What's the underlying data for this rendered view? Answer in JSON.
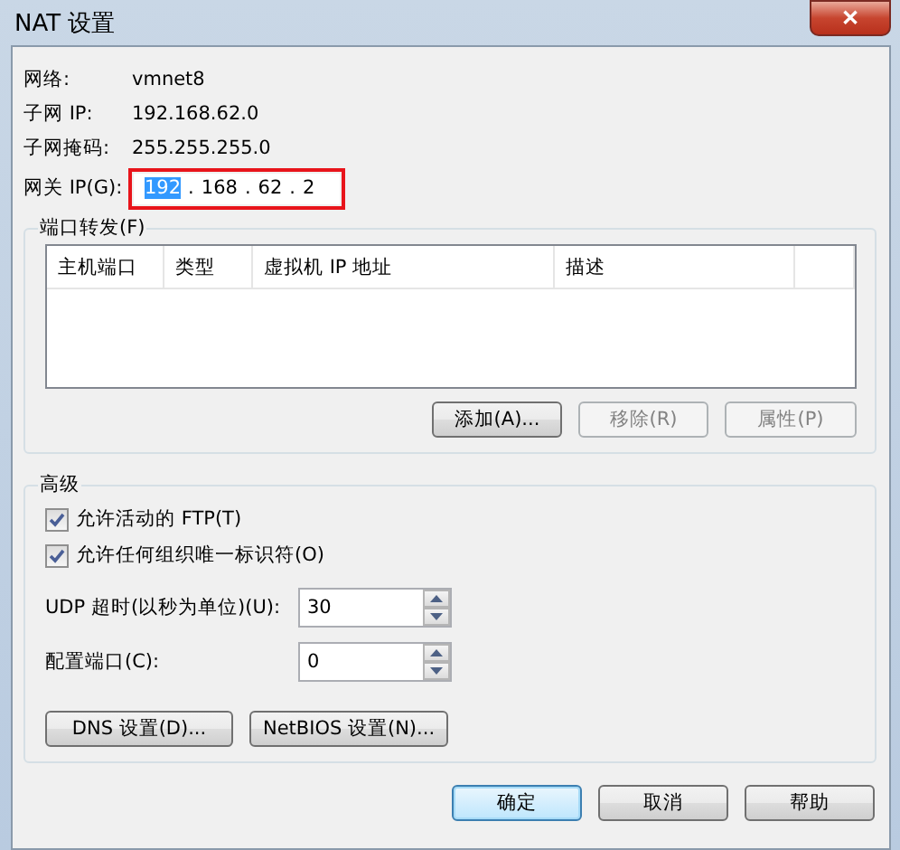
{
  "window": {
    "title": "NAT 设置",
    "close": "✕"
  },
  "info": [
    {
      "label": "网络:",
      "value": "vmnet8"
    },
    {
      "label": "子网 IP:",
      "value": "192.168.62.0"
    },
    {
      "label": "子网掩码:",
      "value": "255.255.255.0"
    }
  ],
  "gateway": {
    "label": "网关 IP(G):",
    "octets": [
      "192",
      "168",
      "62",
      "2"
    ],
    "separator": ".",
    "highlighted": true
  },
  "port_forwarding": {
    "title": "端口转发(F)",
    "columns": [
      "主机端口",
      "类型",
      "虚拟机 IP 地址",
      "描述"
    ],
    "buttons": [
      {
        "label": "添加(A)...",
        "disabled": false
      },
      {
        "label": "移除(R)",
        "disabled": true
      },
      {
        "label": "属性(P)",
        "disabled": true
      }
    ]
  },
  "advanced": {
    "title": "高级",
    "checkboxes": [
      {
        "label": "允许活动的 FTP(T)",
        "checked": true
      },
      {
        "label": "允许任何组织唯一标识符(O)",
        "checked": true
      }
    ],
    "spinners": [
      {
        "label": "UDP 超时(以秒为单位)(U):",
        "value": "30"
      },
      {
        "label": "配置端口(C):",
        "value": "0"
      }
    ],
    "buttons": [
      "DNS 设置(D)...",
      "NetBIOS 设置(N)..."
    ]
  },
  "footer": [
    {
      "label": "确定",
      "default": true
    },
    {
      "label": "取消",
      "default": false
    },
    {
      "label": "帮助",
      "default": false
    }
  ]
}
